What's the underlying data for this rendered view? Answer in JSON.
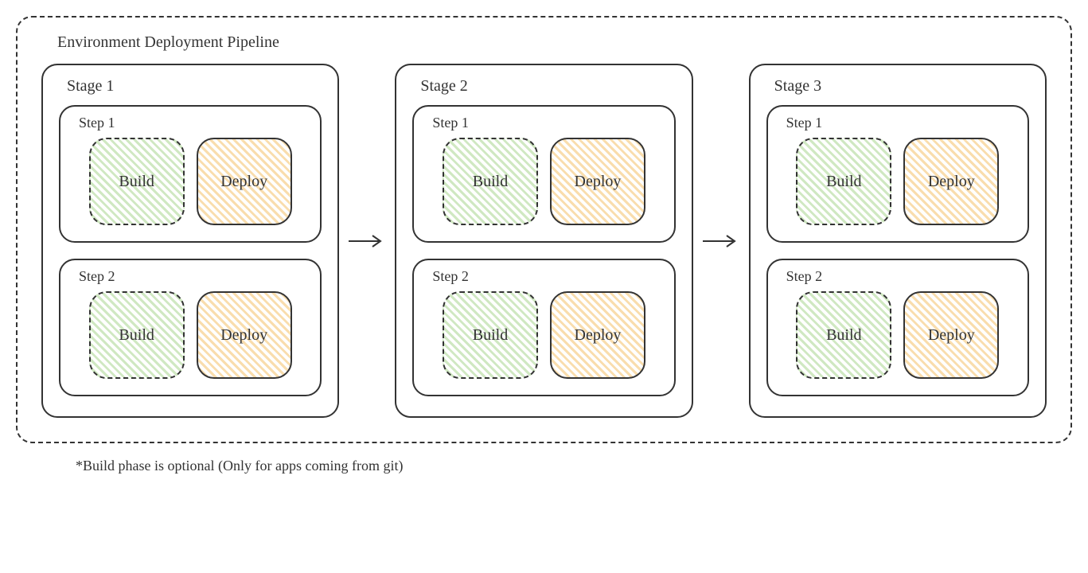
{
  "pipeline": {
    "title": "Environment Deployment Pipeline",
    "footnote": "*Build phase is optional (Only for apps coming from git)",
    "stages": [
      {
        "label": "Stage 1",
        "steps": [
          {
            "label": "Step 1",
            "build": "Build",
            "deploy": "Deploy"
          },
          {
            "label": "Step 2",
            "build": "Build",
            "deploy": "Deploy"
          }
        ]
      },
      {
        "label": "Stage 2",
        "steps": [
          {
            "label": "Step 1",
            "build": "Build",
            "deploy": "Deploy"
          },
          {
            "label": "Step 2",
            "build": "Build",
            "deploy": "Deploy"
          }
        ]
      },
      {
        "label": "Stage 3",
        "steps": [
          {
            "label": "Step 1",
            "build": "Build",
            "deploy": "Deploy"
          },
          {
            "label": "Step 2",
            "build": "Build",
            "deploy": "Deploy"
          }
        ]
      }
    ]
  },
  "colors": {
    "build_hatch": "#78BE50",
    "deploy_hatch": "#F0AA32",
    "stroke": "#333333"
  }
}
